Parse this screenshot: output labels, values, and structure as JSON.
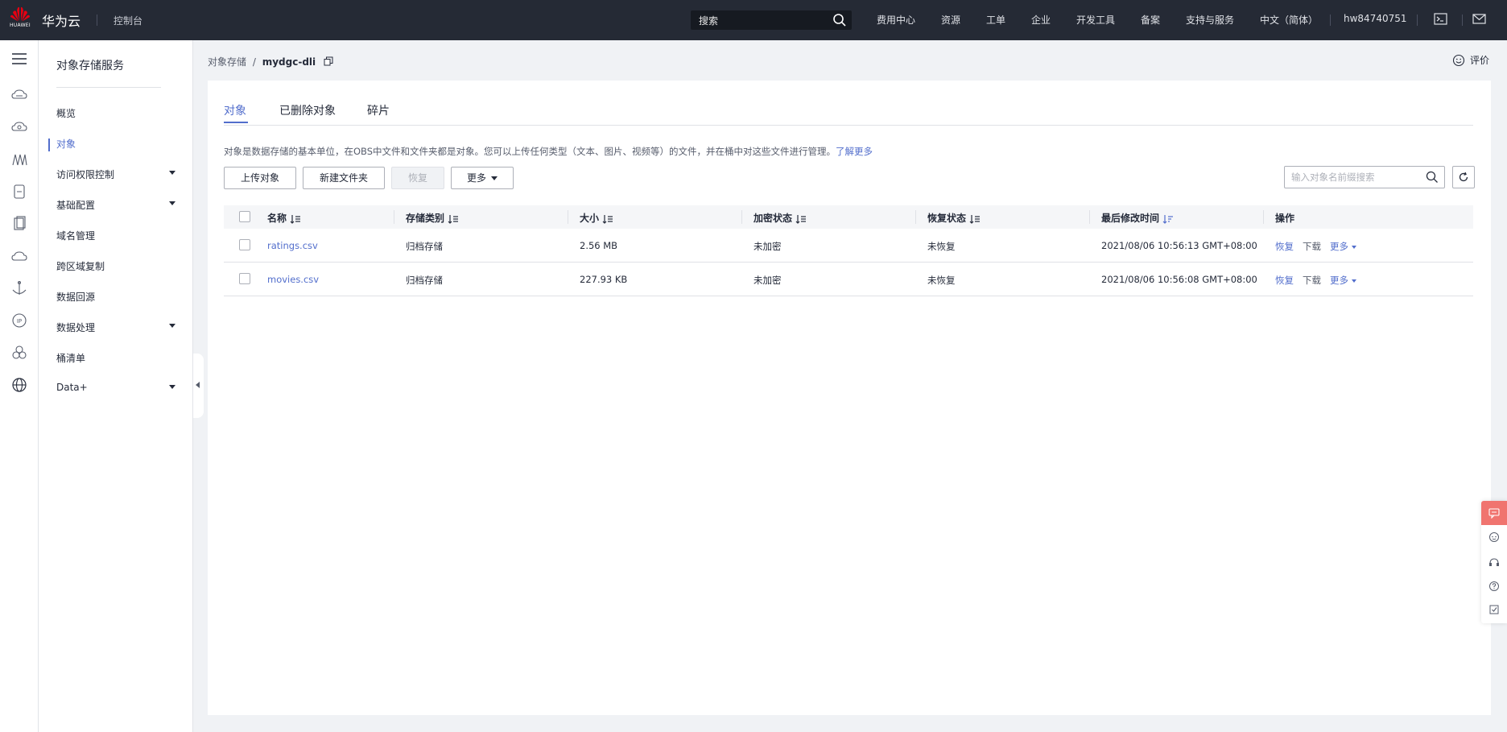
{
  "topbar": {
    "logo_text": "HUAWEI",
    "brand": "华为云",
    "console": "控制台",
    "search_placeholder": "搜索",
    "nav": [
      "费用中心",
      "资源",
      "工单",
      "企业",
      "开发工具",
      "备案",
      "支持与服务",
      "中文（简体）",
      "hw84740751"
    ]
  },
  "rail_icons": [
    "menu-icon",
    "cloud-server-icon",
    "cloud-service-icon",
    "bucket-icon",
    "container-icon",
    "document-icon",
    "cloud-icon",
    "anchor-icon",
    "ip-icon",
    "cluster-icon",
    "globe-icon"
  ],
  "sidebar": {
    "title": "对象存储服务",
    "items": [
      {
        "label": "概览",
        "active": false,
        "expandable": false
      },
      {
        "label": "对象",
        "active": true,
        "expandable": false
      },
      {
        "label": "访问权限控制",
        "active": false,
        "expandable": true
      },
      {
        "label": "基础配置",
        "active": false,
        "expandable": true
      },
      {
        "label": "域名管理",
        "active": false,
        "expandable": false
      },
      {
        "label": "跨区域复制",
        "active": false,
        "expandable": false
      },
      {
        "label": "数据回源",
        "active": false,
        "expandable": false
      },
      {
        "label": "数据处理",
        "active": false,
        "expandable": true
      },
      {
        "label": "桶清单",
        "active": false,
        "expandable": false
      },
      {
        "label": "Data+",
        "active": false,
        "expandable": true
      }
    ]
  },
  "breadcrumb": {
    "parent": "对象存储",
    "sep": "/",
    "current": "mydgc-dli"
  },
  "rate_label": "评价",
  "tabs": [
    "对象",
    "已删除对象",
    "碎片"
  ],
  "description": "对象是数据存储的基本单位，在OBS中文件和文件夹都是对象。您可以上传任何类型（文本、图片、视频等）的文件，并在桶中对这些文件进行管理。",
  "learn_more": "了解更多",
  "toolbar": {
    "upload": "上传对象",
    "new_folder": "新建文件夹",
    "restore": "恢复",
    "more": "更多",
    "filter_placeholder": "输入对象名前缀搜索"
  },
  "table": {
    "headers": [
      "名称",
      "存储类别",
      "大小",
      "加密状态",
      "恢复状态",
      "最后修改时间",
      "操作"
    ],
    "rows": [
      {
        "name": "ratings.csv",
        "storage": "归档存储",
        "size": "2.56 MB",
        "encryption": "未加密",
        "restore": "未恢复",
        "modified": "2021/08/06 10:56:13 GMT+08:00",
        "actions": [
          "恢复",
          "下载",
          "更多"
        ]
      },
      {
        "name": "movies.csv",
        "storage": "归档存储",
        "size": "227.93 KB",
        "encryption": "未加密",
        "restore": "未恢复",
        "modified": "2021/08/06 10:56:08 GMT+08:00",
        "actions": [
          "恢复",
          "下载",
          "更多"
        ]
      }
    ]
  },
  "floating_icons": [
    "chat-icon",
    "robot-icon",
    "headset-icon",
    "help-icon",
    "checklist-icon"
  ],
  "colors": {
    "accent": "#526ecc",
    "topbar": "#252a35",
    "float_accent": "#f0746f"
  }
}
